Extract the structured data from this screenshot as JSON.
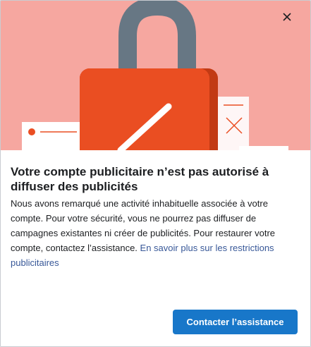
{
  "modal": {
    "title": "Votre compte publicitaire n’est pas autorisé à diffuser des publicités",
    "body": "Nous avons remarqué une activité inhabituelle associée à votre compte. Pour votre sécurité, vous ne pourrez pas diffuser de campagnes existantes ni créer de publicités. Pour restaurer votre compte, contactez l’assistance.",
    "link_label": "En savoir plus sur les restrictions publicitaires",
    "primary_button_label": "Contacter l’assistance",
    "close_icon": "close-icon",
    "illustration_icon": "padlock-icon"
  },
  "colors": {
    "hero_background": "#f6a7a0",
    "padlock_body": "#ea4e22",
    "padlock_shackle": "#677784",
    "primary_button": "#1877c9",
    "link": "#385898"
  }
}
